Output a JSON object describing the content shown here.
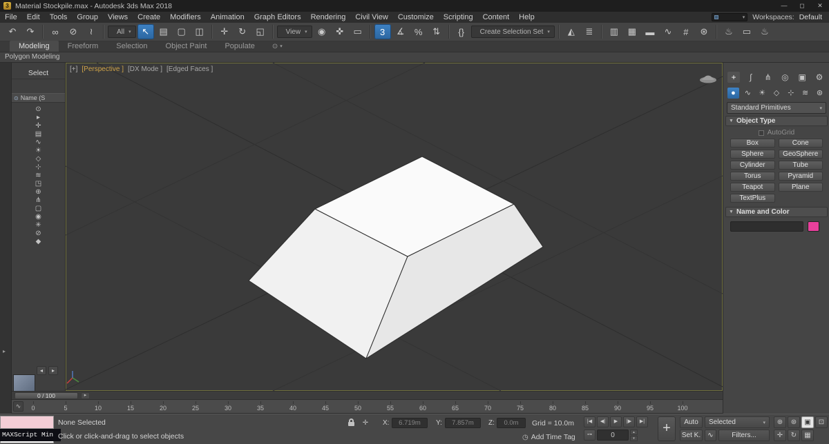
{
  "colors": {
    "accent_blue": "#2d6da3",
    "viewport_bg": "#3a3a3a",
    "swatch": "#e8409c"
  },
  "titlebar": {
    "icon_glyph": "3",
    "title": "Material Stockpile.max - Autodesk 3ds Max 2018",
    "minimize_glyph": "—",
    "maximize_glyph": "◻",
    "close_glyph": "✕"
  },
  "menubar": {
    "items": [
      {
        "name": "menu-file",
        "label": "File"
      },
      {
        "name": "menu-edit",
        "label": "Edit"
      },
      {
        "name": "menu-tools",
        "label": "Tools"
      },
      {
        "name": "menu-group",
        "label": "Group"
      },
      {
        "name": "menu-views",
        "label": "Views"
      },
      {
        "name": "menu-create",
        "label": "Create"
      },
      {
        "name": "menu-modifiers",
        "label": "Modifiers"
      },
      {
        "name": "menu-animation",
        "label": "Animation"
      },
      {
        "name": "menu-graph-editors",
        "label": "Graph Editors"
      },
      {
        "name": "menu-rendering",
        "label": "Rendering"
      },
      {
        "name": "menu-civil-view",
        "label": "Civil View"
      },
      {
        "name": "menu-customize",
        "label": "Customize"
      },
      {
        "name": "menu-scripting",
        "label": "Scripting"
      },
      {
        "name": "menu-content",
        "label": "Content"
      },
      {
        "name": "menu-help",
        "label": "Help"
      }
    ],
    "mini_dropdown_caret": "▾",
    "workspaces_label": "Workspaces:",
    "workspace_value": "Default"
  },
  "toolbar": {
    "items": [
      {
        "name": "undo-icon",
        "type": "icon",
        "glyph": "↶",
        "interactable": "true"
      },
      {
        "name": "redo-icon",
        "type": "icon",
        "glyph": "↷",
        "interactable": "true"
      },
      {
        "name": "toolbar-separator",
        "type": "sep",
        "interactable": "false"
      },
      {
        "name": "select-and-link-icon",
        "type": "icon",
        "glyph": "∞",
        "interactable": "true"
      },
      {
        "name": "unlink-selection-icon",
        "type": "icon",
        "glyph": "⊘",
        "interactable": "true"
      },
      {
        "name": "bind-to-space-warp-icon",
        "type": "icon",
        "glyph": "≀",
        "interactable": "true"
      },
      {
        "name": "toolbar-separator",
        "type": "sep",
        "interactable": "false"
      },
      {
        "name": "selection-filter-dropdown",
        "type": "combo",
        "label": "All",
        "caret": "▾",
        "interactable": "true"
      },
      {
        "name": "select-object-icon",
        "type": "icon",
        "glyph": "↖",
        "active": "true",
        "interactable": "true"
      },
      {
        "name": "select-by-name-icon",
        "type": "icon",
        "glyph": "▤",
        "interactable": "true"
      },
      {
        "name": "rectangular-selection-region-icon",
        "type": "icon",
        "glyph": "▢",
        "interactable": "true"
      },
      {
        "name": "window-crossing-toggle-icon",
        "type": "icon",
        "glyph": "◫",
        "interactable": "true"
      },
      {
        "name": "toolbar-separator",
        "type": "sep",
        "interactable": "false"
      },
      {
        "name": "select-and-move-icon",
        "type": "icon",
        "glyph": "✛",
        "interactable": "true"
      },
      {
        "name": "select-and-rotate-icon",
        "type": "icon",
        "glyph": "↻",
        "interactable": "true"
      },
      {
        "name": "select-and-scale-icon",
        "type": "icon",
        "glyph": "◱",
        "interactable": "true"
      },
      {
        "name": "toolbar-separator",
        "type": "sep",
        "interactable": "false"
      },
      {
        "name": "reference-coordinate-dropdown",
        "type": "combo",
        "label": "View",
        "caret": "▾",
        "interactable": "true"
      },
      {
        "name": "use-pivot-point-icon",
        "type": "icon",
        "glyph": "◉",
        "interactable": "true"
      },
      {
        "name": "select-and-manipulate-icon",
        "type": "icon",
        "glyph": "✜",
        "interactable": "true"
      },
      {
        "name": "keyboard-override-icon",
        "type": "icon",
        "glyph": "▭",
        "interactable": "true"
      },
      {
        "name": "toolbar-separator",
        "type": "sep",
        "interactable": "false"
      },
      {
        "name": "snaps-toggle-3d-icon",
        "type": "icon",
        "glyph": "3",
        "active": "true",
        "interactable": "true"
      },
      {
        "name": "angle-snap-icon",
        "type": "icon",
        "glyph": "∡",
        "interactable": "true"
      },
      {
        "name": "percent-snap-icon",
        "type": "icon",
        "glyph": "%",
        "interactable": "true"
      },
      {
        "name": "spinner-snap-icon",
        "type": "icon",
        "glyph": "⇅",
        "interactable": "true"
      },
      {
        "name": "toolbar-separator",
        "type": "sep",
        "interactable": "false"
      },
      {
        "name": "edit-named-selections-icon",
        "type": "icon",
        "glyph": "{}",
        "interactable": "true"
      },
      {
        "name": "named-selection-set-dropdown",
        "type": "combo",
        "label": "Create Selection Set",
        "caret": "▾",
        "interactable": "true"
      },
      {
        "name": "toolbar-separator",
        "type": "sep",
        "interactable": "false"
      },
      {
        "name": "mirror-icon",
        "type": "icon",
        "glyph": "◭",
        "interactable": "true"
      },
      {
        "name": "align-icon",
        "type": "icon",
        "glyph": "≣",
        "interactable": "true"
      },
      {
        "name": "toolbar-separator",
        "type": "sep",
        "interactable": "false"
      },
      {
        "name": "toggle-scene-explorer-icon",
        "type": "icon",
        "glyph": "▥",
        "interactable": "true"
      },
      {
        "name": "toggle-layer-explorer-icon",
        "type": "icon",
        "glyph": "▦",
        "interactable": "true"
      },
      {
        "name": "toggle-ribbon-icon",
        "type": "icon",
        "glyph": "▬",
        "interactable": "true"
      },
      {
        "name": "curve-editor-icon",
        "type": "icon",
        "glyph": "∿",
        "interactable": "true"
      },
      {
        "name": "schematic-view-icon",
        "type": "icon",
        "glyph": "#",
        "interactable": "true"
      },
      {
        "name": "material-editor-icon",
        "type": "icon",
        "glyph": "⊛",
        "interactable": "true"
      },
      {
        "name": "toolbar-separator",
        "type": "sep",
        "interactable": "false"
      },
      {
        "name": "render-setup-icon",
        "type": "icon",
        "glyph": "♨",
        "interactable": "true"
      },
      {
        "name": "rendered-frame-window-icon",
        "type": "icon",
        "glyph": "▭",
        "interactable": "true"
      },
      {
        "name": "render-production-icon",
        "type": "icon",
        "glyph": "♨",
        "interactable": "true"
      }
    ]
  },
  "ribbon": {
    "tabs": [
      {
        "name": "tab-modeling",
        "label": "Modeling",
        "active": "true"
      },
      {
        "name": "tab-freeform",
        "label": "Freeform"
      },
      {
        "name": "tab-selection",
        "label": "Selection"
      },
      {
        "name": "tab-object-paint",
        "label": "Object Paint"
      },
      {
        "name": "tab-populate",
        "label": "Populate"
      }
    ],
    "config_icon": "⊙",
    "config_caret": "▾",
    "panel_title": "Polygon Modeling"
  },
  "left_strip": {
    "collapse_arrow": "▸"
  },
  "explorer": {
    "menu_label": "Select",
    "header_icon": "⊙",
    "header_label": "Name (S",
    "tools": [
      {
        "name": "sort-icon",
        "glyph": "⊙"
      },
      {
        "name": "expand-icon",
        "glyph": "▸"
      },
      {
        "name": "display-children-icon",
        "glyph": "✛"
      },
      {
        "name": "display-geometry-icon",
        "glyph": "▤"
      },
      {
        "name": "display-shapes-icon",
        "glyph": "∿"
      },
      {
        "name": "display-lights-icon",
        "glyph": "☀"
      },
      {
        "name": "display-cameras-icon",
        "glyph": "◇"
      },
      {
        "name": "display-helpers-icon",
        "glyph": "⊹"
      },
      {
        "name": "display-spacewarps-icon",
        "glyph": "≋"
      },
      {
        "name": "display-groups-icon",
        "glyph": "◳"
      },
      {
        "name": "display-xrefs-icon",
        "glyph": "⊕"
      },
      {
        "name": "display-bones-icon",
        "glyph": "⋔"
      },
      {
        "name": "display-containers-icon",
        "glyph": "▢"
      },
      {
        "name": "display-materials-icon",
        "glyph": "◉"
      },
      {
        "name": "display-frozen-icon",
        "glyph": "✳"
      },
      {
        "name": "display-hidden-icon",
        "glyph": "⊘"
      },
      {
        "name": "pin-explorer-icon",
        "glyph": "◆"
      }
    ],
    "nav_prev": "◂",
    "nav_next": "▸"
  },
  "viewport": {
    "label_menu": "[+]",
    "label_pov": "[Perspective ]",
    "label_mode": "[DX Mode ]",
    "label_shading": "[Edged Faces ]"
  },
  "command_panel": {
    "tabs": [
      {
        "name": "create-tab-icon",
        "glyph": "+",
        "active": "true"
      },
      {
        "name": "modify-tab-icon",
        "glyph": "∫"
      },
      {
        "name": "hierarchy-tab-icon",
        "glyph": "⋔"
      },
      {
        "name": "motion-tab-icon",
        "glyph": "◎"
      },
      {
        "name": "display-tab-icon",
        "glyph": "▣"
      },
      {
        "name": "utilities-tab-icon",
        "glyph": "⚙"
      }
    ],
    "categories": [
      {
        "name": "geometry-category-icon",
        "glyph": "●",
        "active": "true"
      },
      {
        "name": "shapes-category-icon",
        "glyph": "∿"
      },
      {
        "name": "lights-category-icon",
        "glyph": "☀"
      },
      {
        "name": "cameras-category-icon",
        "glyph": "◇"
      },
      {
        "name": "helpers-category-icon",
        "glyph": "⊹"
      },
      {
        "name": "spacewarps-category-icon",
        "glyph": "≋"
      },
      {
        "name": "systems-category-icon",
        "glyph": "⊛"
      }
    ],
    "primitive_dropdown_label": "Standard Primitives",
    "dropdown_caret": "▾",
    "object_type_rollout": {
      "arrow": "▼",
      "title": "Object Type",
      "autogrid_label": "AutoGrid",
      "buttons": [
        {
          "name": "box-button",
          "label": "Box"
        },
        {
          "name": "cone-button",
          "label": "Cone"
        },
        {
          "name": "sphere-button",
          "label": "Sphere"
        },
        {
          "name": "geosphere-button",
          "label": "GeoSphere"
        },
        {
          "name": "cylinder-button",
          "label": "Cylinder"
        },
        {
          "name": "tube-button",
          "label": "Tube"
        },
        {
          "name": "torus-button",
          "label": "Torus"
        },
        {
          "name": "pyramid-button",
          "label": "Pyramid"
        },
        {
          "name": "teapot-button",
          "label": "Teapot"
        },
        {
          "name": "plane-button",
          "label": "Plane"
        },
        {
          "name": "textplus-button",
          "label": "TextPlus"
        }
      ]
    },
    "name_color_rollout": {
      "arrow": "▼",
      "title": "Name and Color",
      "swatch_color": "#e8409c"
    }
  },
  "timeline": {
    "slider_label": "0 / 100",
    "next_glyph": "▸",
    "mini_curve_glyph": "∿",
    "ticks": [
      0,
      5,
      10,
      15,
      20,
      25,
      30,
      35,
      40,
      45,
      50,
      55,
      60,
      65,
      70,
      75,
      80,
      85,
      90,
      95,
      100
    ]
  },
  "statusbar": {
    "maxscript_tooltip": "MAXScript Min",
    "selection_status": "None Selected",
    "prompt": "Click or click-and-drag to select objects",
    "offset_toggle_glyph": "✛",
    "coord_x_label": "X:",
    "coord_x_value": "6.719m",
    "coord_y_label": "Y:",
    "coord_y_value": "7.857m",
    "coord_z_label": "Z:",
    "coord_z_value": "0.0m",
    "grid_label": "Grid = 10.0m",
    "time_tag_icon": "◷",
    "time_tag_label": "Add Time Tag",
    "transport": [
      {
        "name": "go-to-start-button",
        "glyph": "|◀"
      },
      {
        "name": "previous-frame-button",
        "glyph": "◀|"
      },
      {
        "name": "play-button",
        "glyph": "▶"
      },
      {
        "name": "next-frame-button",
        "glyph": "|▶"
      },
      {
        "name": "go-to-end-button",
        "glyph": "▶|"
      }
    ],
    "key_toggle_glyph": "⊶",
    "time_field_value": "0",
    "spinner_up": "▴",
    "spinner_down": "▾",
    "set_keys_glyph": "+",
    "auto_label": "Auto",
    "selected_label": "Selected",
    "selected_caret": "▾",
    "set_key_label": "Set K.",
    "tangent_glyph": "∿",
    "filters_label": "Filters...",
    "nav": [
      {
        "name": "zoom-icon",
        "glyph": "⊕"
      },
      {
        "name": "zoom-all-icon",
        "glyph": "⊛"
      },
      {
        "name": "zoom-extents-icon",
        "glyph": "▣",
        "bright": "true"
      },
      {
        "name": "zoom-region-icon",
        "glyph": "⊡"
      },
      {
        "name": "pan-icon",
        "glyph": "✛"
      },
      {
        "name": "orbit-icon",
        "glyph": "↻"
      },
      {
        "name": "maximize-viewport-icon",
        "glyph": "▦"
      }
    ]
  }
}
